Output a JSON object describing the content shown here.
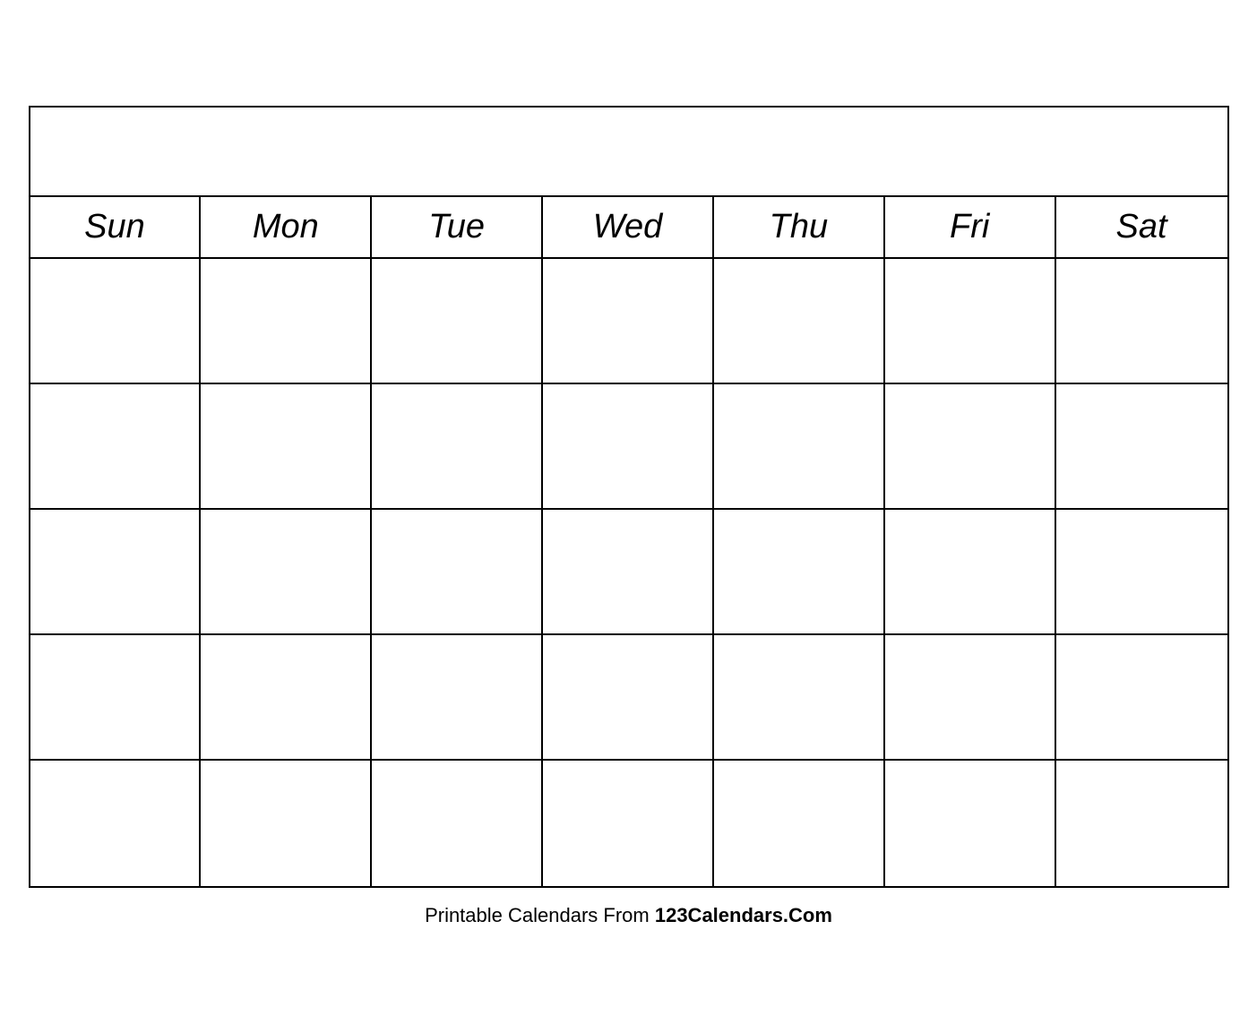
{
  "calendar": {
    "title": "",
    "days": [
      "Sun",
      "Mon",
      "Tue",
      "Wed",
      "Thu",
      "Fri",
      "Sat"
    ],
    "rows": 5
  },
  "footer": {
    "text_normal": "Printable Calendars From ",
    "text_bold": "123Calendars.Com"
  }
}
